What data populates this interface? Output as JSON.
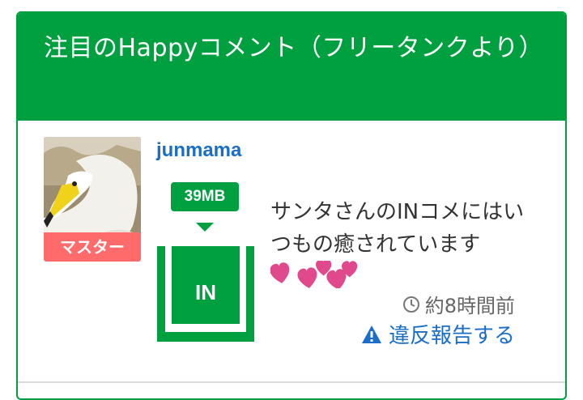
{
  "header": {
    "title": "注目のHappyコメント（フリータンクより）"
  },
  "post": {
    "avatar_badge": "マスター",
    "username": "junmama",
    "size": "39MB",
    "tank_label": "IN",
    "comment": "サンタさんのINコメにはいつもの癒されています",
    "time": "約8時間前",
    "report": "違反報告する"
  },
  "colors": {
    "accent": "#00a040",
    "link": "#1a6ec8",
    "badge": "#ff6b6b",
    "heart": "#e04a8c"
  },
  "icons": {
    "clock": "clock-icon",
    "warning": "warning-icon",
    "hearts": "heart-icon"
  }
}
